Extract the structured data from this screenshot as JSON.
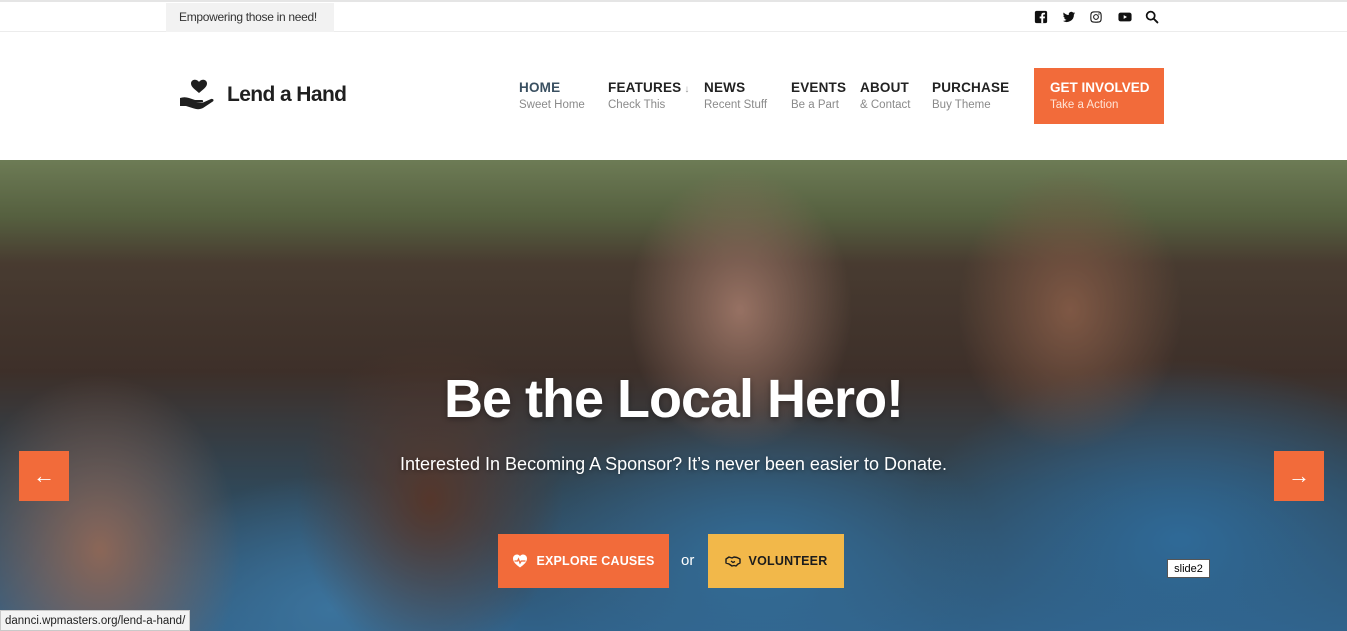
{
  "topbar": {
    "tagline": "Empowering those in need!",
    "social_icons": [
      "facebook-icon",
      "twitter-icon",
      "instagram-icon",
      "youtube-icon",
      "search-icon"
    ]
  },
  "logo": {
    "text": "Lend a Hand",
    "icon": "heart-hand-icon"
  },
  "nav": [
    {
      "title": "HOME",
      "sub": "Sweet Home"
    },
    {
      "title": "FEATURES",
      "sub": "Check This",
      "arrow": "↓"
    },
    {
      "title": "NEWS",
      "sub": "Recent Stuff"
    },
    {
      "title": "EVENTS",
      "sub": "Be a Part"
    },
    {
      "title": "ABOUT",
      "sub": "& Contact"
    },
    {
      "title": "PURCHASE",
      "sub": "Buy Theme"
    }
  ],
  "cta": {
    "title": "GET INVOLVED",
    "sub": "Take a Action"
  },
  "hero": {
    "title": "Be the Local Hero!",
    "subtitle": "Interested In Becoming A Sponsor? It’s never been easier to Donate.",
    "prev_arrow": "←",
    "next_arrow": "→",
    "explore_label": "EXPLORE CAUSES",
    "or_text": "or",
    "volunteer_label": "VOLUNTEER",
    "slide_tag": "slide2"
  },
  "status_bar": {
    "url": "dannci.wpmasters.org/lend-a-hand/"
  },
  "colors": {
    "accent": "#f26b3a",
    "secondary": "#f2b84a",
    "text_dark": "#222222"
  }
}
